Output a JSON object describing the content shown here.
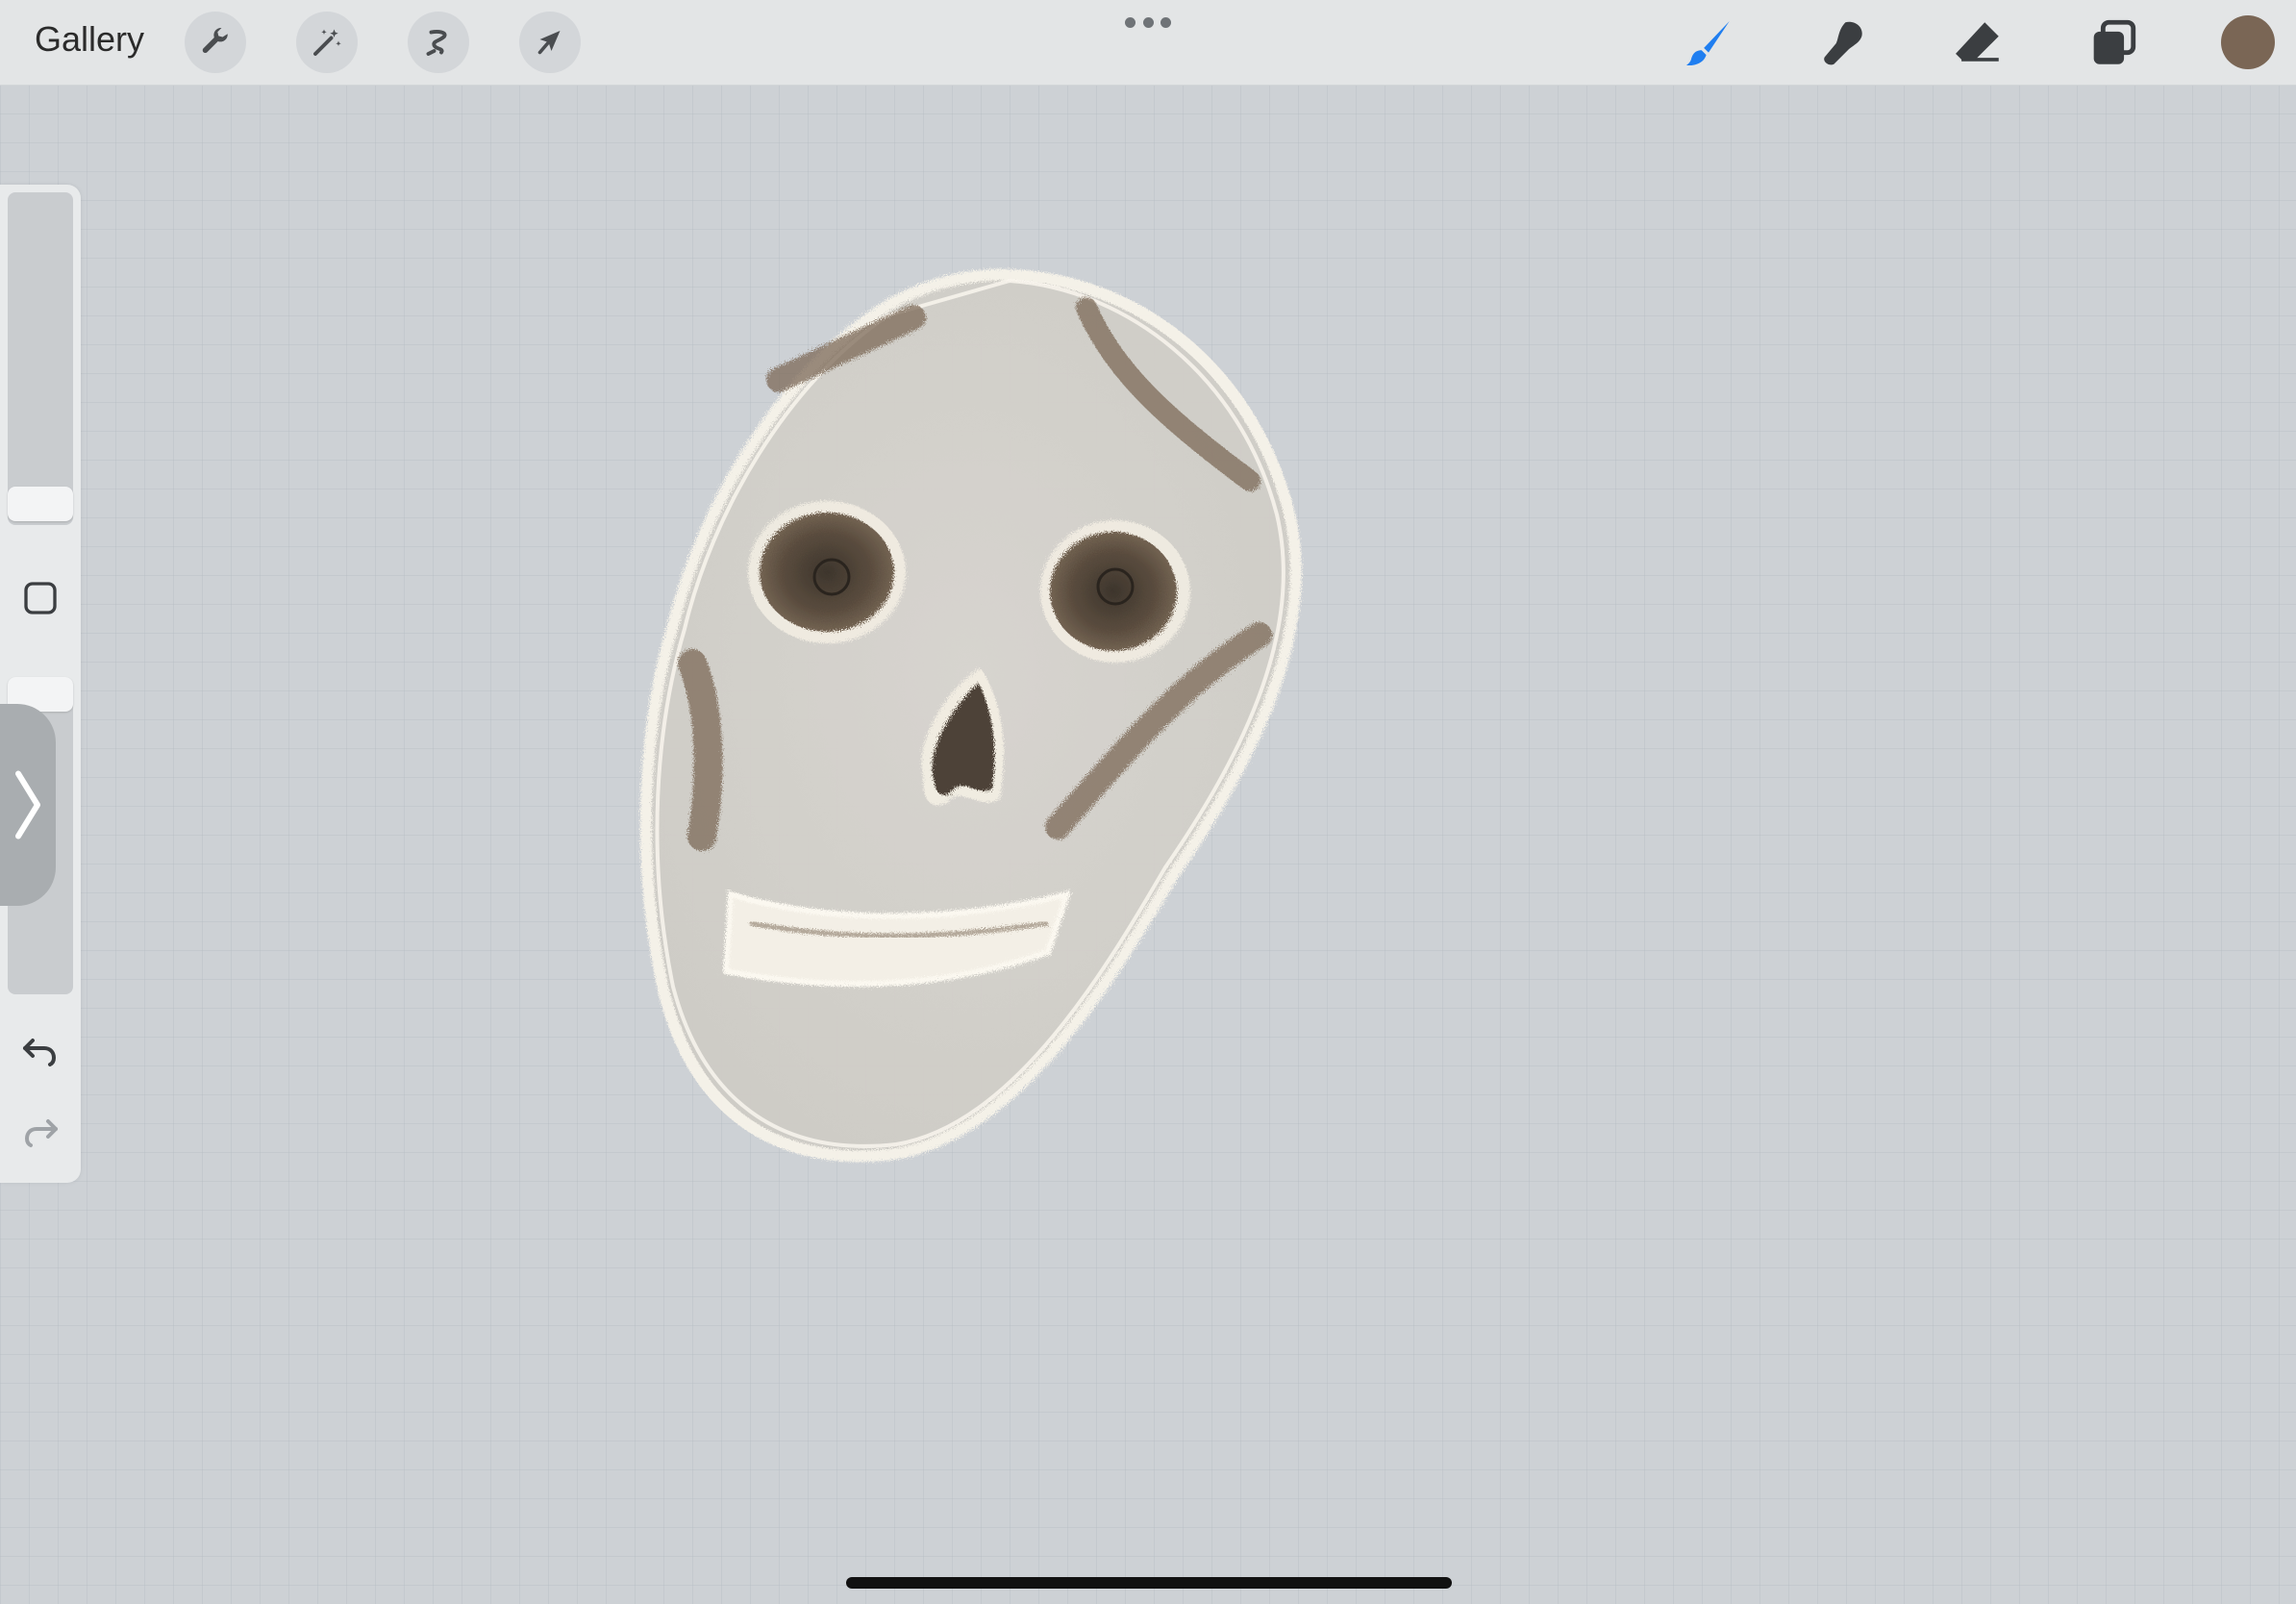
{
  "topbar": {
    "gallery_label": "Gallery",
    "left_tools": [
      "wrench-icon",
      "magic-wand-icon",
      "selection-icon",
      "transform-arrow-icon"
    ],
    "more_menu": "more-dots-icon",
    "right_tools": [
      "brush-icon",
      "smudge-icon",
      "eraser-icon",
      "layers-icon"
    ],
    "active_tool": "brush-icon",
    "current_color": "#7a6655"
  },
  "sidebar": {
    "brush_size_level": 0.4,
    "opacity_level": 0.0,
    "controls": [
      "brush-size-slider",
      "modify-button",
      "opacity-slider",
      "undo-button",
      "redo-button"
    ]
  },
  "colors": {
    "accent": "#1f7ef0",
    "canvas": "#cdd1d5",
    "toolbar": "#e3e5e6"
  }
}
